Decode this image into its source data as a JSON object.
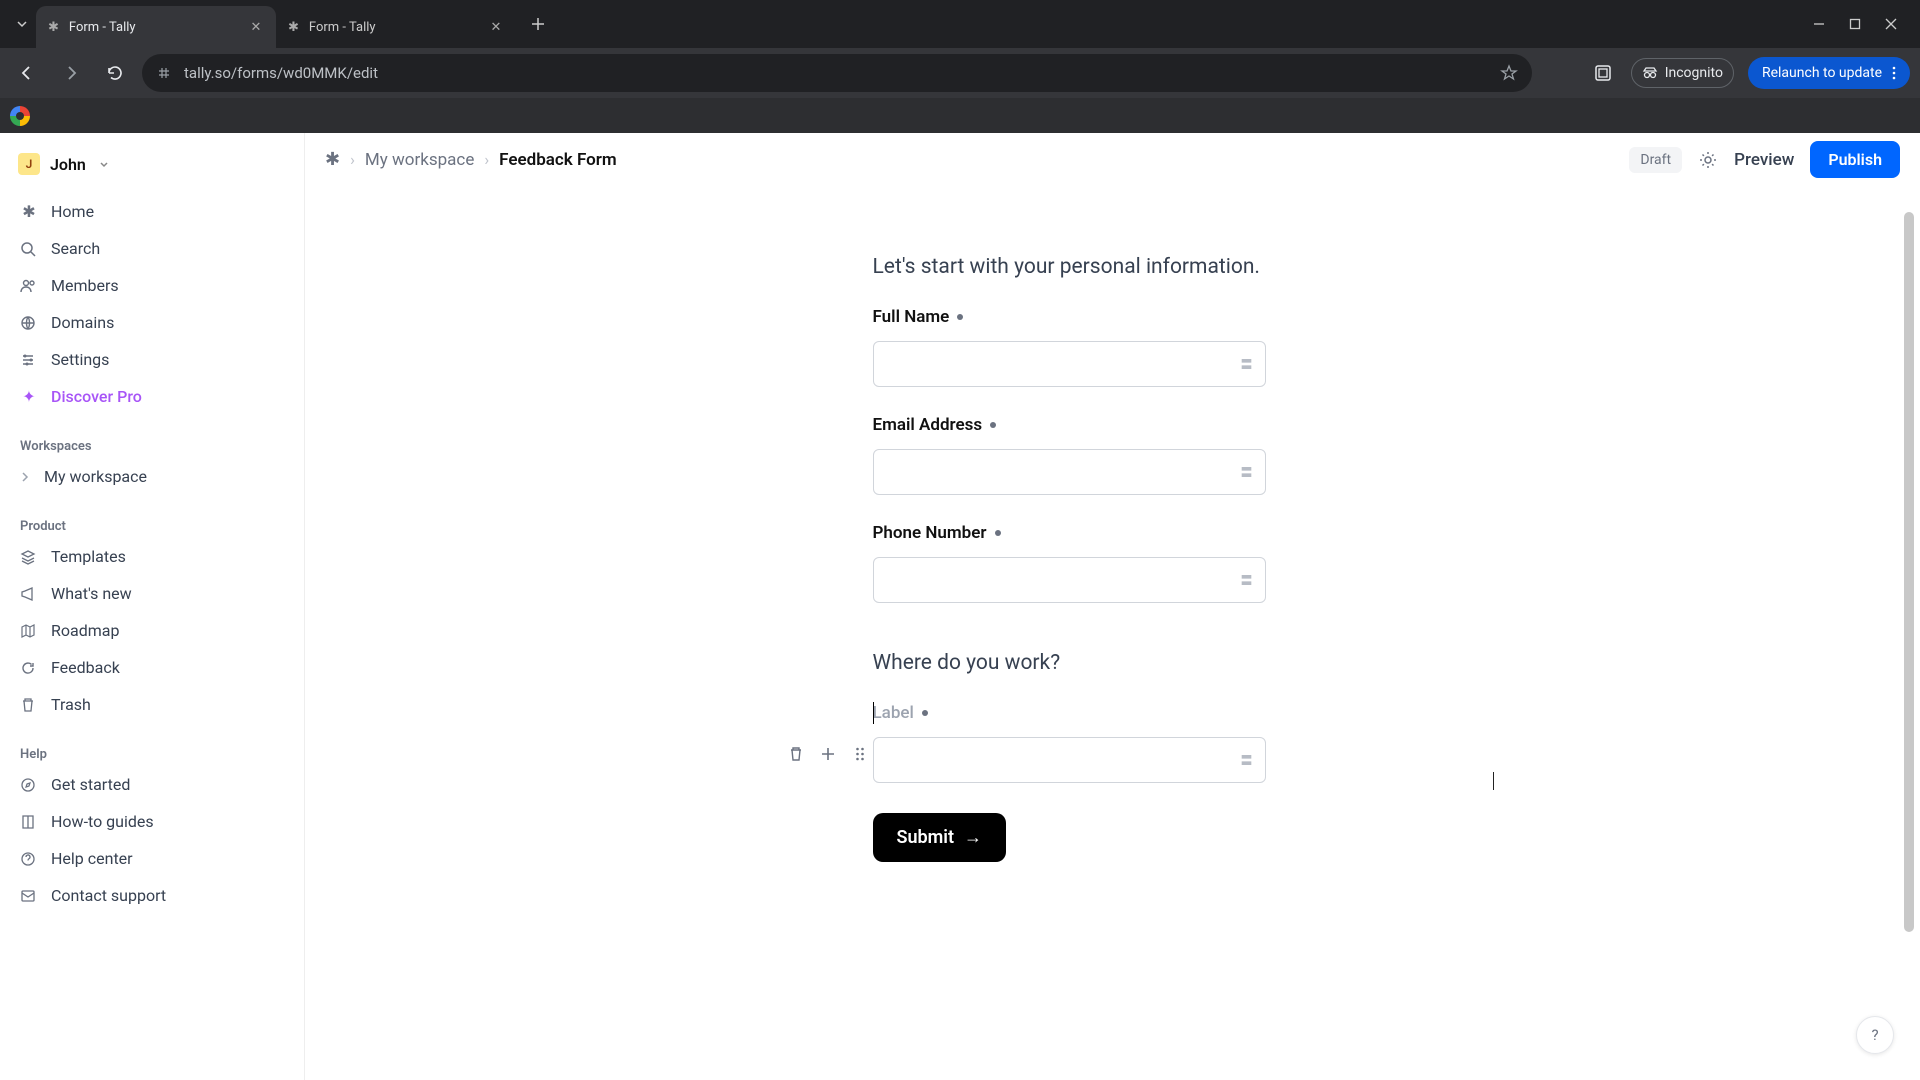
{
  "browser": {
    "tabs": [
      {
        "title": "Form - Tally",
        "active": true
      },
      {
        "title": "Form - Tally",
        "active": false
      }
    ],
    "url": "tally.so/forms/wd0MMK/edit",
    "incognito_label": "Incognito",
    "relaunch_label": "Relaunch to update"
  },
  "sidebar": {
    "user": {
      "initial": "J",
      "name": "John"
    },
    "nav": [
      {
        "label": "Home",
        "icon": "✱"
      },
      {
        "label": "Search",
        "icon": "search"
      },
      {
        "label": "Members",
        "icon": "users"
      },
      {
        "label": "Domains",
        "icon": "globe"
      },
      {
        "label": "Settings",
        "icon": "sliders"
      },
      {
        "label": "Discover Pro",
        "icon": "sparkle",
        "pro": true
      }
    ],
    "workspaces_header": "Workspaces",
    "workspaces": [
      {
        "label": "My workspace"
      }
    ],
    "product_header": "Product",
    "product": [
      {
        "label": "Templates",
        "icon": "layers"
      },
      {
        "label": "What's new",
        "icon": "megaphone"
      },
      {
        "label": "Roadmap",
        "icon": "map"
      },
      {
        "label": "Feedback",
        "icon": "refresh"
      },
      {
        "label": "Trash",
        "icon": "trash"
      }
    ],
    "help_header": "Help",
    "help": [
      {
        "label": "Get started",
        "icon": "compass"
      },
      {
        "label": "How-to guides",
        "icon": "book"
      },
      {
        "label": "Help center",
        "icon": "question"
      },
      {
        "label": "Contact support",
        "icon": "mail"
      }
    ]
  },
  "breadcrumb": {
    "workspace": "My workspace",
    "form": "Feedback Form"
  },
  "topbar": {
    "draft_badge": "Draft",
    "preview_label": "Preview",
    "publish_label": "Publish"
  },
  "form": {
    "section1_text": "Let's start with your personal information.",
    "fields": [
      {
        "label": "Full Name",
        "required": true
      },
      {
        "label": "Email Address",
        "required": true
      },
      {
        "label": "Phone Number",
        "required": true
      }
    ],
    "section2_text": "Where do you work?",
    "new_field": {
      "placeholder_label": "Label",
      "required": true
    },
    "submit_label": "Submit"
  },
  "help_fab": "?"
}
